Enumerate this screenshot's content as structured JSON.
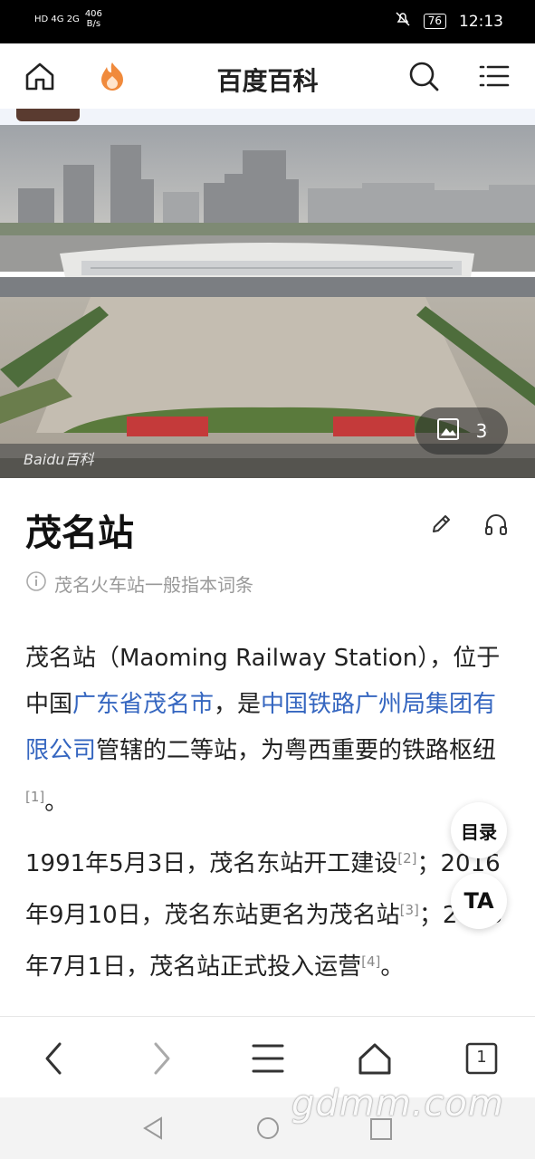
{
  "status": {
    "left_icons": "HD 4G 2G",
    "net_speed_value": "406",
    "net_speed_unit": "B/s",
    "battery": "76",
    "time": "12:13"
  },
  "header": {
    "title": "百度百科"
  },
  "hero": {
    "gallery_count": "3",
    "watermark": "Baidu百科"
  },
  "article": {
    "title": "茂名站",
    "disambiguation": "茂名火车站一般指本词条",
    "p1": {
      "t1": "茂名站（Maoming Railway Station），位于中国",
      "link1": "广东省茂名市",
      "t2": "，是",
      "link2": "中国铁路广州局集团有限公司",
      "t3": "管辖的二等站，为粤西重要的铁路枢纽",
      "ref1": "[1]",
      "t4": "。"
    },
    "p2": {
      "t1": "1991年5月3日，茂名东站开工建设",
      "ref2": "[2]",
      "t2": "；2016年9月10日，茂名东站更名为茂名站",
      "ref3": "[3]",
      "t3": "；2018年7月1日，茂名站正式投入运营",
      "ref4": "[4]",
      "t4": "。"
    }
  },
  "floating": {
    "toc_label": "目录",
    "font_label": "TA"
  },
  "bottom": {
    "tab_count": "1"
  },
  "site_watermark": "gdmm.com",
  "colors": {
    "link": "#3566c0",
    "accent_flame": "#f08a3c"
  }
}
